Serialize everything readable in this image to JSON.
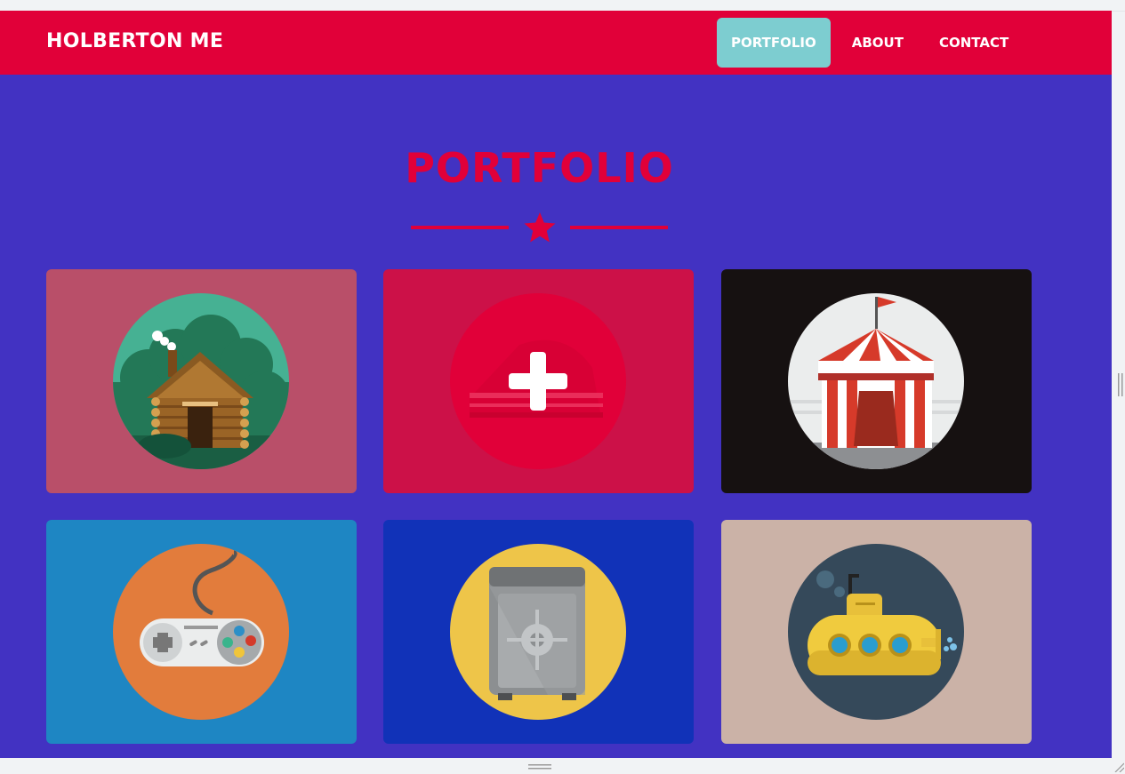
{
  "navbar": {
    "brand": "HOLBERTON ME",
    "links": [
      {
        "label": "PORTFOLIO",
        "active": true
      },
      {
        "label": "ABOUT",
        "active": false
      },
      {
        "label": "CONTACT",
        "active": false
      }
    ]
  },
  "portfolio": {
    "title": "PORTFOLIO",
    "divider_icon": "star-icon",
    "items": [
      {
        "icon": "cabin-icon",
        "background": "#b94f69",
        "circle": "#46b193"
      },
      {
        "icon": "cake-plus-icon",
        "background": "#cc1148",
        "circle": "#e10039"
      },
      {
        "icon": "circus-tent-icon",
        "background": "#161111",
        "circle": "#ebeded"
      },
      {
        "icon": "game-controller-icon",
        "background": "#1e86c3",
        "circle": "#e27c3c"
      },
      {
        "icon": "safe-icon",
        "background": "#1132b8",
        "circle": "#eec549"
      },
      {
        "icon": "submarine-icon",
        "background": "#cbb2a7",
        "circle": "#35495a"
      }
    ]
  },
  "colors": {
    "page_background": "#4232c2",
    "navbar": "#e10039",
    "active_link": "#7dcdd0",
    "accent": "#e10039"
  }
}
